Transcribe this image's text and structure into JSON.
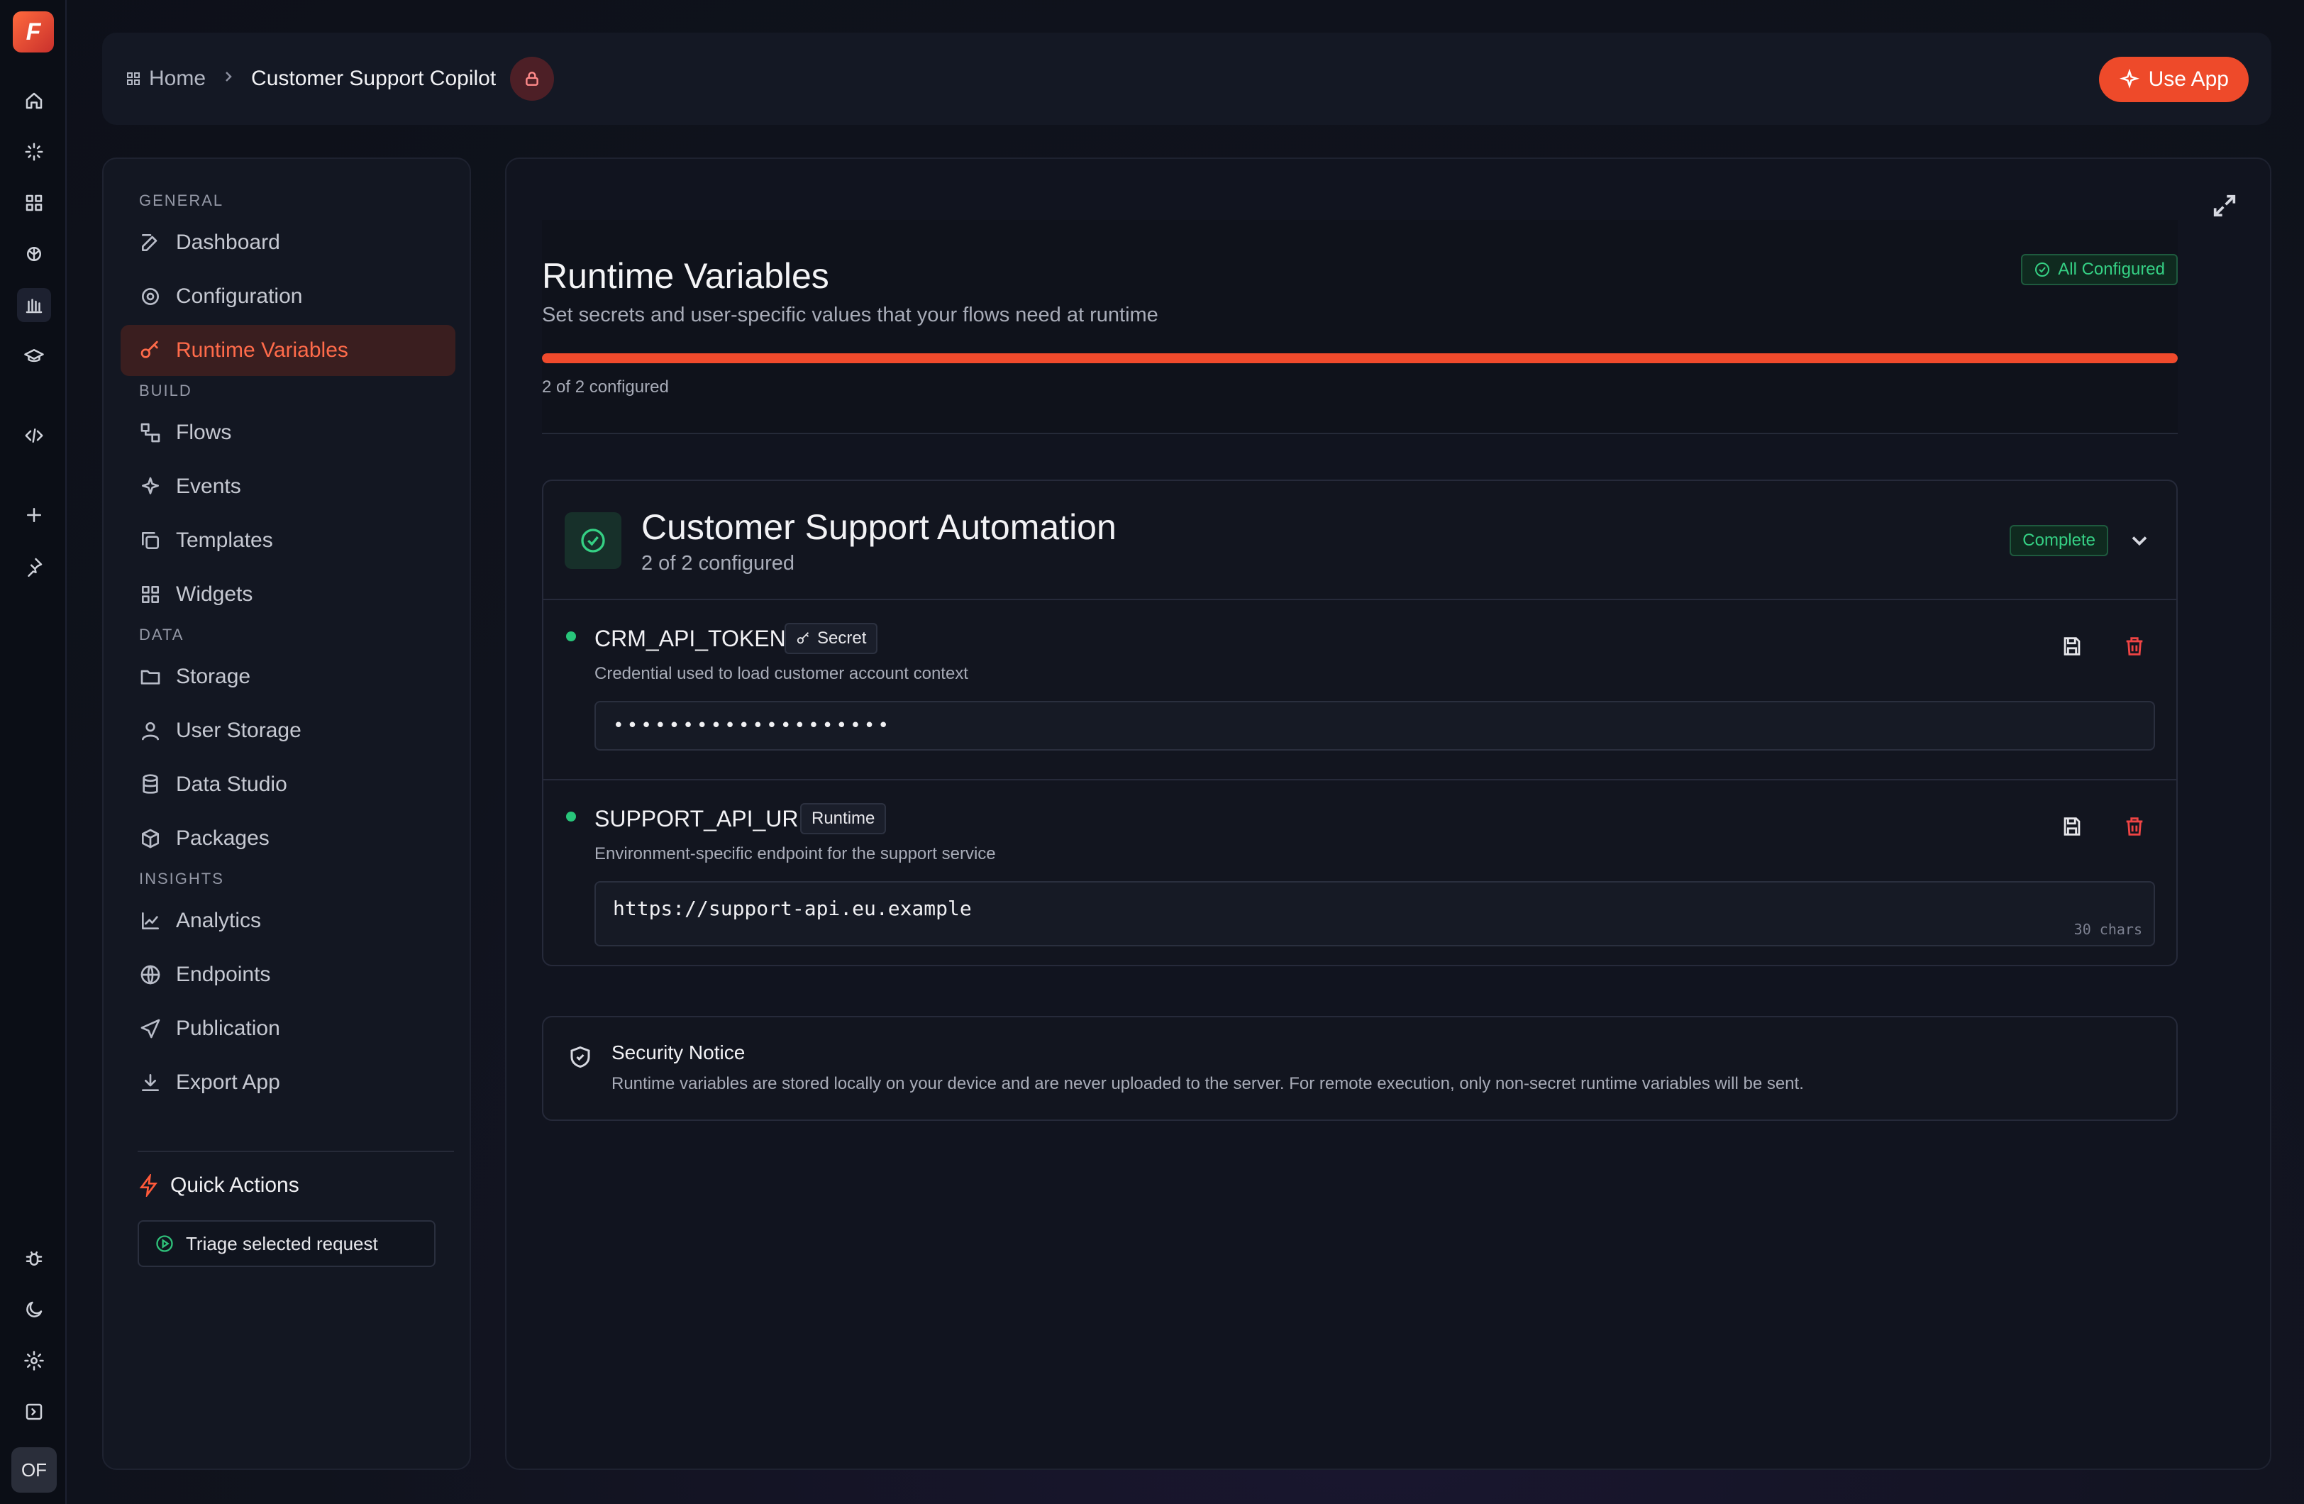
{
  "rail": {
    "logo": "F",
    "avatar": "OF"
  },
  "header": {
    "home_label": "Home",
    "current": "Customer Support Copilot",
    "use_app": "Use App"
  },
  "nav": {
    "sections": {
      "general": "GENERAL",
      "build": "BUILD",
      "data": "DATA",
      "insights": "INSIGHTS"
    },
    "items": {
      "dashboard": "Dashboard",
      "configuration": "Configuration",
      "runtime_variables": "Runtime Variables",
      "flows": "Flows",
      "events": "Events",
      "templates": "Templates",
      "widgets": "Widgets",
      "storage": "Storage",
      "user_storage": "User Storage",
      "data_studio": "Data Studio",
      "packages": "Packages",
      "analytics": "Analytics",
      "endpoints": "Endpoints",
      "publication": "Publication",
      "export_app": "Export App"
    },
    "active": "runtime_variables",
    "quick_actions_title": "Quick Actions",
    "quick_action": "Triage selected request"
  },
  "main": {
    "title": "Runtime Variables",
    "subtitle": "Set secrets and user-specific values that your flows need at runtime",
    "status_badge": "All Configured",
    "progress_fraction": 1.0,
    "progress_text": "2 of 2 configured",
    "group": {
      "title": "Customer Support Automation",
      "subtitle": "2 of 2 configured",
      "badge": "Complete",
      "variables": [
        {
          "name": "CRM_API_TOKEN",
          "tag": "Secret",
          "description": "Credential used to load customer account context",
          "value": "••••••••••••••••••••"
        },
        {
          "name": "SUPPORT_API_URL",
          "tag": "Runtime",
          "description": "Environment-specific endpoint for the support service",
          "value": "https://support-api.eu.example",
          "char_count": "30 chars"
        }
      ]
    },
    "notice": {
      "title": "Security Notice",
      "text": "Runtime variables are stored locally on your device and are never uploaded to the server. For remote execution, only non-secret runtime variables will be sent."
    }
  },
  "colors": {
    "accent": "#ee4a2a",
    "success": "#35d084",
    "danger": "#ef4444"
  }
}
